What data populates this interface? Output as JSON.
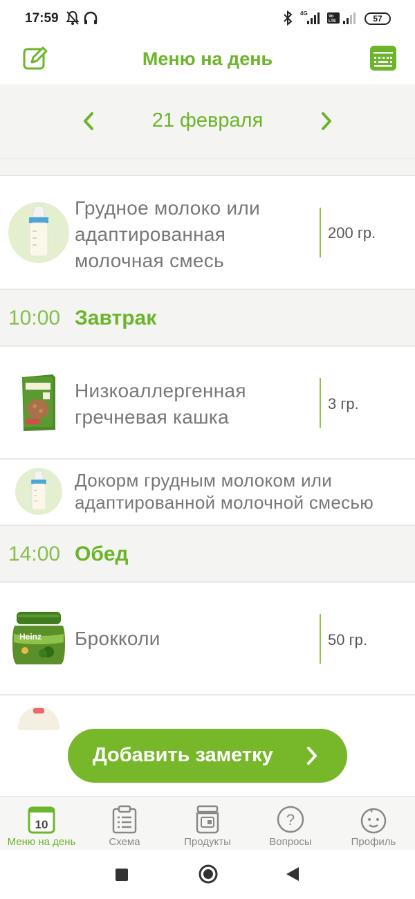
{
  "status_bar": {
    "time": "17:59",
    "battery": "57",
    "icons": [
      "bell-off-icon",
      "headphones-icon",
      "bluetooth-icon",
      "signal-4g-icon",
      "volte-icon",
      "signal-icon",
      "battery-icon"
    ]
  },
  "header": {
    "title": "Меню на день",
    "left_icon": "edit-icon",
    "right_icon": "keyboard-icon"
  },
  "date_nav": {
    "date": "21 февраля",
    "prev_icon": "chevron-left-icon",
    "next_icon": "chevron-right-icon"
  },
  "feed": {
    "items": [
      {
        "name_lines": [
          "Грудное молоко или",
          "адаптированная",
          "молочная смесь"
        ],
        "amount": "200 гр.",
        "icon": "baby-bottle-icon"
      },
      {
        "name_lines": [
          "Низкоаллергенная",
          "гречневая кашка"
        ],
        "amount": "3 гр.",
        "icon": "cereal-box-icon"
      },
      {
        "name_lines": [
          "Докорм грудным молоком или",
          "адаптированной молочной смесью"
        ],
        "icon": "baby-bottle-icon"
      },
      {
        "name_lines": [
          "Брокколи"
        ],
        "amount": "50 гр.",
        "icon": "puree-jar-icon"
      }
    ],
    "meals": [
      {
        "time": "10:00",
        "name": "Завтрак"
      },
      {
        "time": "14:00",
        "name": "Обед"
      }
    ]
  },
  "add_note": {
    "label": "Добавить заметку",
    "icon": "chevron-right-icon"
  },
  "bottom_nav": {
    "items": [
      {
        "label": "Меню на день",
        "icon": "calendar-icon",
        "badge": "10",
        "active": true
      },
      {
        "label": "Схема",
        "icon": "clipboard-icon"
      },
      {
        "label": "Продукты",
        "icon": "jar-icon"
      },
      {
        "label": "Вопросы",
        "icon": "question-icon"
      },
      {
        "label": "Профиль",
        "icon": "baby-face-icon"
      }
    ]
  },
  "system_nav": [
    "square-recent-icon",
    "circle-home-icon",
    "triangle-back-icon"
  ],
  "colors": {
    "accent": "#6cb52a",
    "button": "#76b82a",
    "meal_bg": "#f4f4f2"
  }
}
